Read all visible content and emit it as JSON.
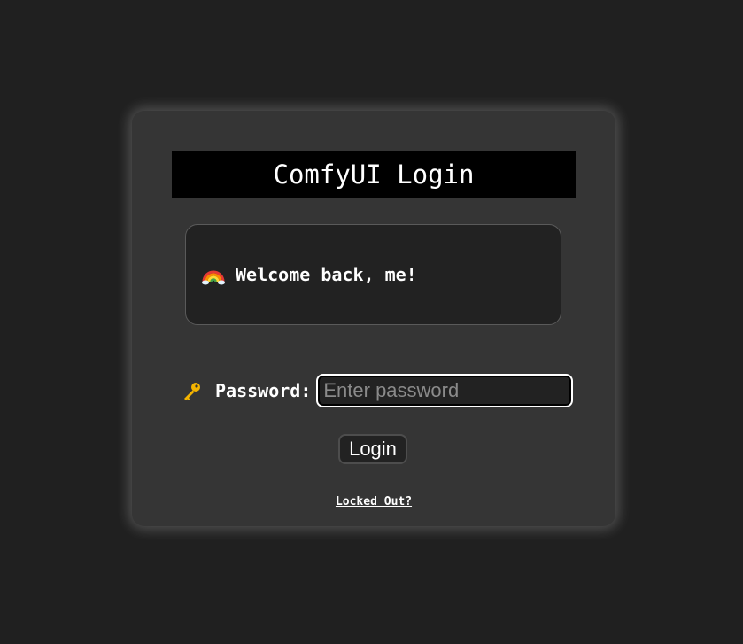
{
  "login": {
    "title": "ComfyUI Login",
    "welcome_message": "Welcome back, me!",
    "password_label": "Password:",
    "password_placeholder": "Enter password",
    "password_value": "",
    "login_button": "Login",
    "locked_out_link": "Locked Out?"
  },
  "icons": {
    "welcome": "rainbow-icon",
    "password": "key-icon"
  },
  "colors": {
    "background": "#202020",
    "card": "#353535",
    "title_bar": "#000000",
    "text": "#ffffff"
  }
}
